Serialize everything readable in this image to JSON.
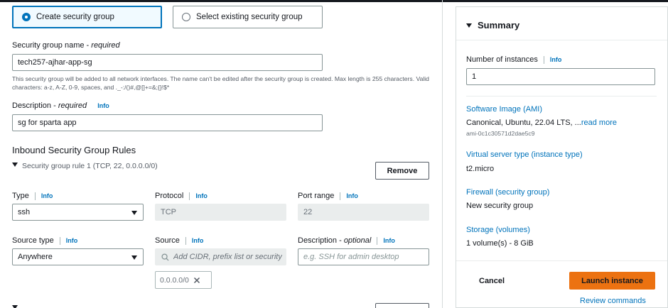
{
  "sg_options": {
    "create_label": "Create security group",
    "select_label": "Select existing security group"
  },
  "sg_name": {
    "label": "Security group name",
    "required": "required",
    "value": "tech257-ajhar-app-sg",
    "hint": "This security group will be added to all network interfaces. The name can't be edited after the security group is created. Max length is 255 characters. Valid characters: a-z, A-Z, 0-9, spaces, and ._-:/()#,@[]+=&;{}!$*"
  },
  "description": {
    "label": "Description",
    "required": "required",
    "info": "Info",
    "value": "sg for sparta app"
  },
  "inbound": {
    "heading": "Inbound Security Group Rules",
    "rule_title": "Security group rule 1 (TCP, 22, 0.0.0.0/0)",
    "remove_label": "Remove",
    "type_label": "Type",
    "type_info": "Info",
    "type_value": "ssh",
    "protocol_label": "Protocol",
    "protocol_info": "Info",
    "protocol_value": "TCP",
    "port_label": "Port range",
    "port_info": "Info",
    "port_value": "22",
    "source_type_label": "Source type",
    "source_type_info": "Info",
    "source_type_value": "Anywhere",
    "source_label": "Source",
    "source_info": "Info",
    "source_placeholder": "Add CIDR, prefix list or security",
    "source_token": "0.0.0.0/0",
    "desc_label": "Description",
    "desc_optional": "optional",
    "desc_info": "Info",
    "desc_placeholder": "e.g. SSH for admin desktop"
  },
  "summary": {
    "title": "Summary",
    "instances_label": "Number of instances",
    "instances_info": "Info",
    "instances_value": "1",
    "ami_label": "Software Image (AMI)",
    "ami_value": "Canonical, Ubuntu, 22.04 LTS, ...",
    "ami_more": "read more",
    "ami_id": "ami-0c1c30571d2dae5c9",
    "type_label": "Virtual server type (instance type)",
    "type_value": "t2.micro",
    "firewall_label": "Firewall (security group)",
    "firewall_value": "New security group",
    "storage_label": "Storage (volumes)",
    "storage_value": "1 volume(s) - 8 GiB",
    "cancel_label": "Cancel",
    "launch_label": "Launch instance",
    "review_label": "Review commands"
  },
  "colors": {
    "accent": "#0073bb",
    "launch": "#ec7211"
  }
}
